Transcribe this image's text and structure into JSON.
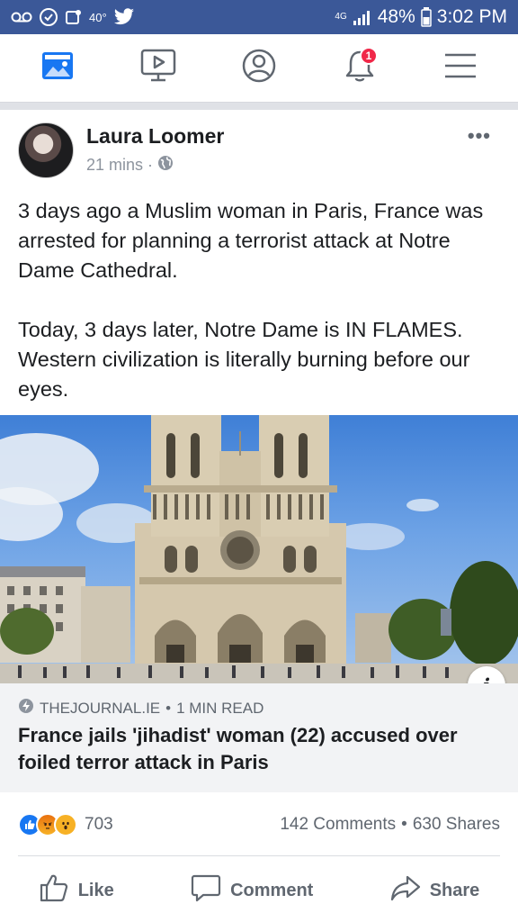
{
  "status_bar": {
    "left_icons": [
      "voicemail-icon",
      "whatsapp-icon",
      "notification-icon",
      "twitter-icon"
    ],
    "temperature": "40°",
    "network": "4G",
    "battery": "48%",
    "time": "3:02 PM"
  },
  "nav": {
    "items": [
      {
        "name": "news-feed",
        "icon": "news-feed-icon"
      },
      {
        "name": "watch",
        "icon": "video-icon"
      },
      {
        "name": "profile",
        "icon": "profile-icon"
      },
      {
        "name": "notifications",
        "icon": "bell-icon",
        "badge": "1"
      },
      {
        "name": "menu",
        "icon": "hamburger-menu-icon"
      }
    ]
  },
  "post": {
    "author": "Laura Loomer",
    "time": "21 mins",
    "privacy_icon": "globe-icon",
    "more": "•••",
    "text_paragraphs": [
      "3 days ago a Muslim woman in Paris, France was arrested for planning a terrorist attack at Notre Dame Cathedral.",
      "Today, 3 days later, Notre Dame is IN FLAMES. Western civilization is literally burning before our eyes."
    ],
    "link": {
      "source": "THEJOURNAL.IE",
      "read_time": "1 MIN READ",
      "title": "France jails 'jihadist' woman (22) accused over foiled terror attack in Paris",
      "info_label": "i"
    },
    "reactions": {
      "icons": [
        "like-reaction-icon",
        "angry-reaction-icon",
        "wow-reaction-icon"
      ],
      "count": "703"
    },
    "comments": "142 Comments",
    "shares": "630 Shares",
    "actions": {
      "like": "Like",
      "comment": "Comment",
      "share": "Share"
    }
  },
  "colors": {
    "status_bar": "#3b5898",
    "nav_blue": "#1877f2",
    "badge_red": "#f02849",
    "link_box": "#f2f3f5"
  }
}
